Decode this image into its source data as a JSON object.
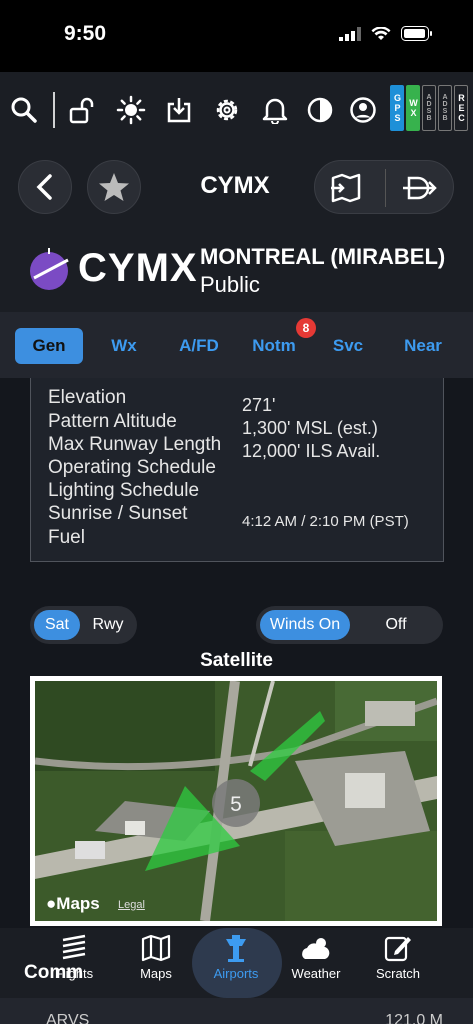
{
  "status": {
    "time": "9:50"
  },
  "toolbar": {
    "badges": {
      "gps": "GPS",
      "wx": "WX",
      "adsb1": "ADSB",
      "adsb2": "ADSB",
      "rec": "REC"
    }
  },
  "nav": {
    "title": "CYMX"
  },
  "header": {
    "code": "CYMX",
    "name": "MONTREAL (MIRABEL)",
    "type": "Public"
  },
  "tabs": [
    {
      "label": "Gen",
      "active": true
    },
    {
      "label": "Wx"
    },
    {
      "label": "A/FD"
    },
    {
      "label": "Notm",
      "badge": "8"
    },
    {
      "label": "Svc"
    },
    {
      "label": "Near"
    }
  ],
  "info": [
    {
      "label": "Elevation",
      "value": "271'"
    },
    {
      "label": "Pattern Altitude",
      "value": "1,300' MSL (est.)"
    },
    {
      "label": "Max Runway Length",
      "value": "12,000' ILS Avail."
    },
    {
      "label": "Operating Schedule",
      "value": ""
    },
    {
      "label": "Lighting Schedule",
      "value": ""
    },
    {
      "label": "Sunrise / Sunset",
      "value": "4:12 AM / 2:10 PM (PST)"
    },
    {
      "label": "Fuel",
      "value": ""
    }
  ],
  "map_toggle": {
    "sat": "Sat",
    "rwy": "Rwy",
    "selected": "Sat"
  },
  "winds_toggle": {
    "on": "Winds On",
    "off": "Off",
    "selected": "Winds On"
  },
  "map": {
    "title": "Satellite",
    "wind_marker": "5",
    "attribution": "Maps",
    "legal": "Legal"
  },
  "bottom_nav": [
    {
      "label": "Flights",
      "icon": "flights-icon"
    },
    {
      "label": "Maps",
      "icon": "map-icon"
    },
    {
      "label": "Airports",
      "icon": "tower-icon",
      "active": true
    },
    {
      "label": "Weather",
      "icon": "weather-icon"
    },
    {
      "label": "Scratch",
      "icon": "scratch-icon"
    }
  ],
  "comm": {
    "title": "Comm",
    "first_row_label": "ARVS",
    "first_row_value": "121.0 M"
  },
  "colors": {
    "accent": "#3d8fe0",
    "tab_text": "#3d9bf0",
    "badge": "#e53935",
    "logo": "#7b4bc4"
  }
}
